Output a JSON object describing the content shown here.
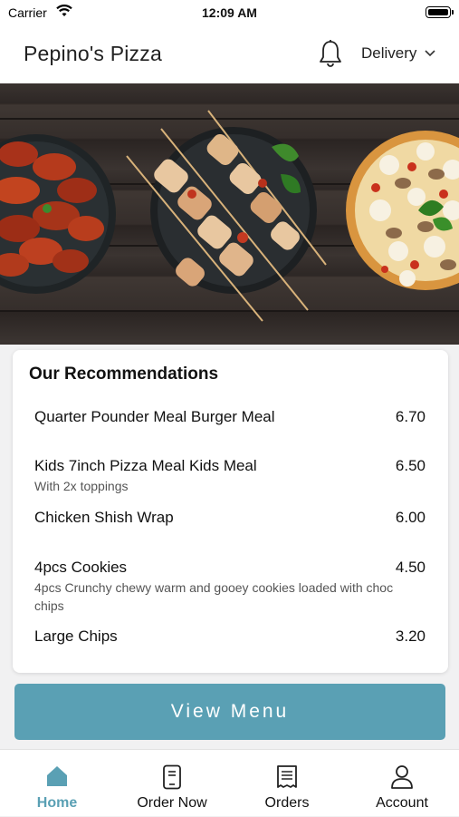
{
  "status_bar": {
    "carrier": "Carrier",
    "time": "12:09 AM"
  },
  "header": {
    "title": "Pepino's Pizza",
    "delivery_label": "Delivery"
  },
  "recommendations": {
    "title": "Our Recommendations",
    "items": [
      {
        "name": "Quarter Pounder Meal Burger Meal",
        "price": "6.70",
        "desc": ""
      },
      {
        "name": "Kids 7inch Pizza Meal Kids Meal",
        "price": "6.50",
        "desc": "With 2x toppings"
      },
      {
        "name": "Chicken Shish Wrap",
        "price": "6.00",
        "desc": ""
      },
      {
        "name": "4pcs Cookies",
        "price": "4.50",
        "desc": "4pcs Crunchy chewy warm and gooey cookies loaded with choc chips"
      },
      {
        "name": "Large Chips",
        "price": "3.20",
        "desc": ""
      }
    ]
  },
  "view_menu_label": "View Menu",
  "tabs": [
    {
      "label": "Home",
      "icon": "home-icon",
      "active": true
    },
    {
      "label": "Order Now",
      "icon": "phone-order-icon",
      "active": false
    },
    {
      "label": "Orders",
      "icon": "receipt-icon",
      "active": false
    },
    {
      "label": "Account",
      "icon": "person-icon",
      "active": false
    }
  ],
  "colors": {
    "accent": "#5aa0b4",
    "text": "#111111",
    "muted": "#555555"
  }
}
